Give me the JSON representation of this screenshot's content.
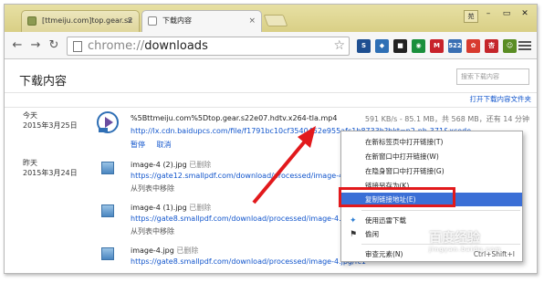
{
  "tabs": [
    {
      "title": "[ttmeiju.com]top.gear.s2",
      "close": "×"
    },
    {
      "title": "下载内容",
      "close": "×"
    }
  ],
  "window": {
    "user": "苑",
    "minimize": "–",
    "maximize": "▭",
    "close": "✕"
  },
  "address": {
    "scheme": "chrome://",
    "path": "downloads"
  },
  "extensions": [
    {
      "name": "ext-icon-1",
      "label": "S",
      "color": "#1e4f91"
    },
    {
      "name": "ext-icon-2",
      "label": "◆",
      "color": "#2e6fb5"
    },
    {
      "name": "ext-icon-3",
      "label": "■",
      "color": "#222222"
    },
    {
      "name": "ext-icon-4",
      "label": "◉",
      "color": "#1a8f3c"
    },
    {
      "name": "ext-icon-5",
      "label": "M",
      "color": "#c8232b"
    },
    {
      "name": "ext-icon-6",
      "label": "522",
      "color": "#3a6fb3"
    },
    {
      "name": "ext-icon-7",
      "label": "✿",
      "color": "#d83b2f"
    },
    {
      "name": "ext-icon-8",
      "label": "杏",
      "color": "#c5262b"
    },
    {
      "name": "ext-icon-9",
      "label": "☺",
      "color": "#5a8d24"
    }
  ],
  "page": {
    "title": "下载内容",
    "search_placeholder": "搜索下载内容",
    "open_folder": "打开下载内容文件夹"
  },
  "downloads": [
    {
      "date_line1": "今天",
      "date_line2": "2015年3月25日",
      "name": "%5Bttmeiju.com%5Dtop.gear.s22e07.hdtv.x264-tla.mp4",
      "status": "",
      "progress": "591 KB/s - 85.1 MB，共 568 MB，还有 14 分钟",
      "url": "http://lx.cdn.baidupcs.com/file/f1791bc10cf3540452e955afc1b8733b?bkt=p2-nb-371&xcode...",
      "actions": [
        "暂停",
        "取消"
      ]
    },
    {
      "date_line1": "昨天",
      "date_line2": "2015年3月24日",
      "name": "image-4 (2).jpg",
      "status": "已删除",
      "url": "https://gate12.smallpdf.com/download/processed/image-4.jpg/8",
      "actions": [
        "从列表中移除"
      ]
    },
    {
      "date_line1": "",
      "date_line2": "",
      "name": "image-4 (1).jpg",
      "status": "已删除",
      "url": "https://gate8.smallpdf.com/download/processed/image-4.jpg/8",
      "actions": [
        "从列表中移除"
      ]
    },
    {
      "date_line1": "",
      "date_line2": "",
      "name": "image-4.jpg",
      "status": "已删除",
      "url": "https://gate8.smallpdf.com/download/processed/image-4.jpg/fc1",
      "actions": [
        "从列表中移除"
      ]
    }
  ],
  "context_menu": {
    "items": [
      {
        "label": "在新标签页中打开链接(T)",
        "shortcut": ""
      },
      {
        "label": "在新窗口中打开链接(W)",
        "shortcut": ""
      },
      {
        "label": "在隐身窗口中打开链接(G)",
        "shortcut": ""
      },
      {
        "label": "链接另存为(K)...",
        "shortcut": ""
      },
      {
        "label": "复制链接地址(E)",
        "shortcut": ""
      },
      {
        "label": "使用迅雷下载",
        "shortcut": ""
      },
      {
        "label": "偷闲",
        "shortcut": ""
      },
      {
        "label": "审查元素(N)",
        "shortcut": "Ctrl+Shift+I"
      }
    ],
    "highlighted_index": 4
  },
  "watermark": {
    "brand": "百度经验",
    "sub": "jingyan.baidu.com"
  },
  "colors": {
    "highlight": "#3b6fd6",
    "annotation_red": "#e2191c",
    "link": "#1155cc"
  }
}
